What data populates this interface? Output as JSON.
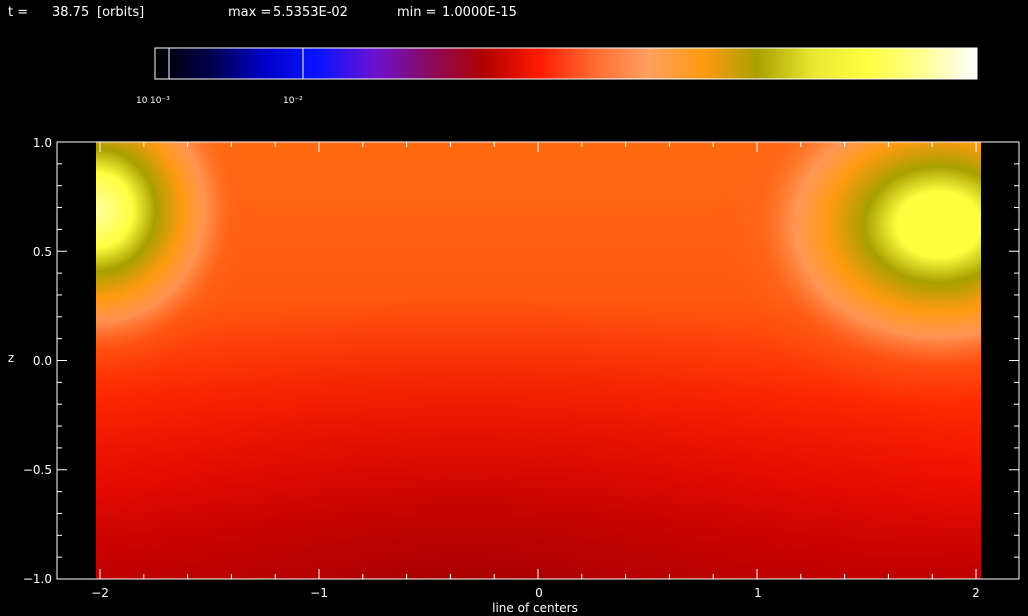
{
  "header": {
    "time_label": "t =",
    "time_value": "38.75",
    "time_unit": "[orbits]",
    "max_label": "max =",
    "max_value": "5.5353E-02",
    "min_label": "min =",
    "min_value": "1.0000E-15"
  },
  "colorbar": {
    "tick_labels": [
      "10",
      "10⁻³",
      "10⁻²"
    ],
    "stops": [
      "#000000",
      "#00004a",
      "#0000c8",
      "#0a14ff",
      "#6a12d0",
      "#8a0a60",
      "#b00000",
      "#ff1a00",
      "#ff6a30",
      "#ffa060",
      "#ff9a10",
      "#a8a000",
      "#e8e830",
      "#ffff40",
      "#ffff90",
      "#ffffff"
    ]
  },
  "chart_data": {
    "type": "heatmap",
    "xlabel": "line of centers",
    "ylabel": "z",
    "xlim": [
      -2,
      2
    ],
    "ylim": [
      -1,
      1
    ],
    "x_ticks": [
      -2,
      -1,
      0,
      1,
      2
    ],
    "x_tick_labels": [
      "−2",
      "−1",
      "0",
      "1",
      "2"
    ],
    "y_ticks": [
      1.0,
      0.5,
      0.0,
      -0.5,
      -1.0
    ],
    "y_tick_labels": [
      "1.0",
      "0.5",
      "0.0",
      "−0.5",
      "−1.0"
    ],
    "colors": {
      "bright": "#ffff40",
      "olive": "#a8a000",
      "orange": "#ff9a10",
      "peach": "#ffa060",
      "orange_red": "#ff6a20",
      "red": "#ff1a00",
      "dark_red": "#c80000"
    }
  }
}
